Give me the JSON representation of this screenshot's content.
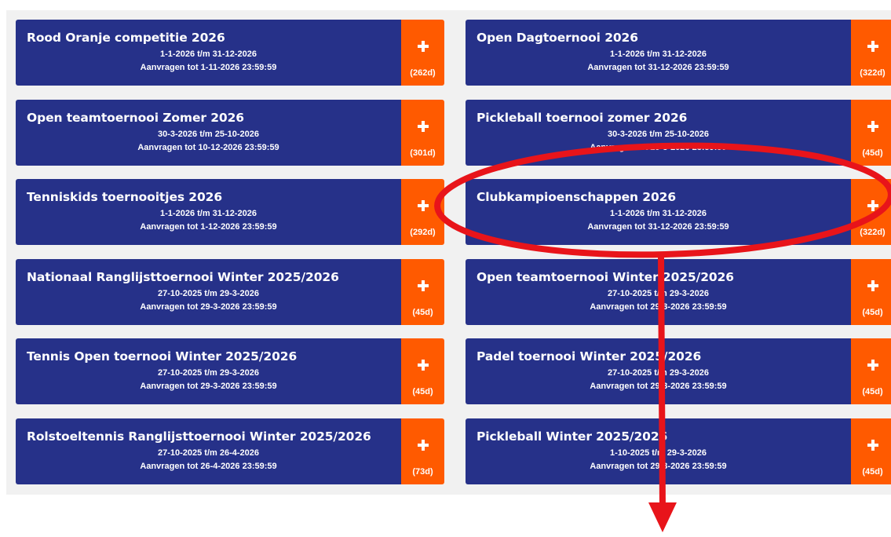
{
  "colors": {
    "card": "#263189",
    "action": "#ff5a00",
    "annotation": "#e8141a",
    "panel": "#f1f1f1"
  },
  "tournaments": [
    {
      "title": "Rood Oranje competitie 2026",
      "dates": "1-1-2026 t/m 31-12-2026",
      "deadline": "Aanvragen tot 1-11-2026 23:59:59",
      "days": "(262d)"
    },
    {
      "title": "Open Dagtoernooi 2026",
      "dates": "1-1-2026 t/m 31-12-2026",
      "deadline": "Aanvragen tot 31-12-2026 23:59:59",
      "days": "(322d)"
    },
    {
      "title": "Open teamtoernooi Zomer 2026",
      "dates": "30-3-2026 t/m 25-10-2026",
      "deadline": "Aanvragen tot 10-12-2026 23:59:59",
      "days": "(301d)"
    },
    {
      "title": "Pickleball toernooi zomer 2026",
      "dates": "30-3-2026 t/m 25-10-2026",
      "deadline": "Aanvragen tot 29-3-2026 23:59:59",
      "days": "(45d)"
    },
    {
      "title": "Tenniskids toernooitjes 2026",
      "dates": "1-1-2026 t/m 31-12-2026",
      "deadline": "Aanvragen tot 1-12-2026 23:59:59",
      "days": "(292d)"
    },
    {
      "title": "Clubkampioenschappen 2026",
      "dates": "1-1-2026 t/m 31-12-2026",
      "deadline": "Aanvragen tot 31-12-2026 23:59:59",
      "days": "(322d)"
    },
    {
      "title": "Nationaal Ranglijsttoernooi Winter 2025/2026",
      "dates": "27-10-2025 t/m 29-3-2026",
      "deadline": "Aanvragen tot 29-3-2026 23:59:59",
      "days": "(45d)"
    },
    {
      "title": "Open teamtoernooi Winter 2025/2026",
      "dates": "27-10-2025 t/m 29-3-2026",
      "deadline": "Aanvragen tot 29-3-2026 23:59:59",
      "days": "(45d)"
    },
    {
      "title": "Tennis Open toernooi Winter 2025/2026",
      "dates": "27-10-2025 t/m 29-3-2026",
      "deadline": "Aanvragen tot 29-3-2026 23:59:59",
      "days": "(45d)"
    },
    {
      "title": "Padel toernooi Winter 2025/2026",
      "dates": "27-10-2025 t/m 29-3-2026",
      "deadline": "Aanvragen tot 29-3-2026 23:59:59",
      "days": "(45d)"
    },
    {
      "title": "Rolstoeltennis Ranglijsttoernooi Winter 2025/2026",
      "dates": "27-10-2025 t/m 26-4-2026",
      "deadline": "Aanvragen tot 26-4-2026 23:59:59",
      "days": "(73d)"
    },
    {
      "title": "Pickleball Winter 2025/2026",
      "dates": "1-10-2025 t/m 29-3-2026",
      "deadline": "Aanvragen tot 29-3-2026 23:59:59",
      "days": "(45d)"
    }
  ]
}
